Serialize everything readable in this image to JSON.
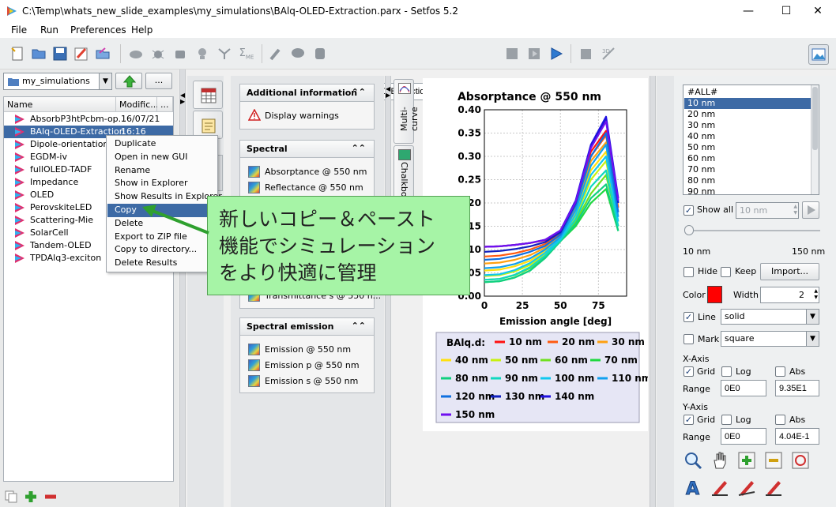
{
  "window": {
    "title": "C:\\Temp\\whats_new_slide_examples\\my_simulations\\BAlq-OLED-Extraction.parx - Setfos 5.2",
    "minimize": "—",
    "maximize": "☐",
    "close": "✕"
  },
  "menubar": {
    "items": [
      "File",
      "Run",
      "Preferences",
      "Help"
    ]
  },
  "toolbar": {
    "simulation_name": "BAlq-OLED-Extraction"
  },
  "left": {
    "folder": "my_simulations",
    "more_button": "...",
    "columns": {
      "name": "Name",
      "modified": "Modific...",
      "more": "..."
    },
    "files": [
      {
        "name": "AbsorbP3htPcbm-op...",
        "date": "16/07/21"
      },
      {
        "name": "BAlq-OLED-Extraction",
        "date": "16:16"
      },
      {
        "name": "Dipole-orientation",
        "date": ""
      },
      {
        "name": "EGDM-iv",
        "date": ""
      },
      {
        "name": "fullOLED-TADF",
        "date": ""
      },
      {
        "name": "Impedance",
        "date": ""
      },
      {
        "name": "OLED",
        "date": ""
      },
      {
        "name": "PerovskiteLED",
        "date": ""
      },
      {
        "name": "Scattering-Mie",
        "date": ""
      },
      {
        "name": "SolarCell",
        "date": ""
      },
      {
        "name": "Tandem-OLED",
        "date": ""
      },
      {
        "name": "TPDAlq3-exciton",
        "date": ""
      }
    ]
  },
  "context_menu": {
    "items": [
      "Duplicate",
      "Open in new GUI",
      "Rename",
      "Show in Explorer",
      "Show Results in Explorer",
      "Copy",
      "Delete",
      "Export to ZIP file",
      "Copy to directory...",
      "Delete Results"
    ],
    "highlighted": "Copy"
  },
  "callout": {
    "lines": [
      "新しいコピー＆ペースト",
      "機能でシミュレーション",
      "をより快適に管理"
    ]
  },
  "middle": {
    "sections": [
      {
        "title": "Additional information",
        "items": [
          "Display warnings"
        ]
      },
      {
        "title": "Spectral",
        "items": [
          "Absorptance @ 550 nm",
          "Reflectance @ 550 nm"
        ],
        "hidden_item": "Transmittance s @ 550 n..."
      },
      {
        "title": "Spectral emission",
        "items": [
          "Emission @ 550 nm",
          "Emission p @ 550 nm",
          "Emission s @ 550 nm"
        ]
      }
    ],
    "side_tabs": [
      "Multi-curve",
      "Chalkboard"
    ]
  },
  "chart_data": {
    "type": "line",
    "title": "Absorptance @ 550 nm",
    "xlabel": "Emission angle [deg]",
    "ylabel": "",
    "xlim": [
      0,
      93.5
    ],
    "ylim": [
      0,
      0.4
    ],
    "xticks": [
      0,
      25,
      50,
      75
    ],
    "yticks": [
      "0.00",
      "0.05",
      "0.10",
      "0.15",
      "0.20",
      "0.25",
      "0.30",
      "0.35",
      "0.40"
    ],
    "grid": true,
    "legend_title": "BAlq.d:",
    "legend_position": "bottom",
    "series": [
      {
        "name": "10 nm",
        "color": "#ff1010",
        "values": [
          0.106,
          0.107,
          0.11,
          0.114,
          0.12,
          0.14,
          0.2,
          0.31,
          0.355,
          0.2
        ]
      },
      {
        "name": "20 nm",
        "color": "#ff5a10",
        "values": [
          0.085,
          0.087,
          0.092,
          0.1,
          0.112,
          0.135,
          0.195,
          0.3,
          0.345,
          0.19
        ]
      },
      {
        "name": "30 nm",
        "color": "#ffa010",
        "values": [
          0.07,
          0.072,
          0.078,
          0.088,
          0.104,
          0.13,
          0.19,
          0.29,
          0.33,
          0.18
        ]
      },
      {
        "name": "40 nm",
        "color": "#ffe010",
        "values": [
          0.055,
          0.057,
          0.064,
          0.076,
          0.097,
          0.126,
          0.18,
          0.27,
          0.31,
          0.17
        ]
      },
      {
        "name": "50 nm",
        "color": "#c8f010",
        "values": [
          0.043,
          0.045,
          0.053,
          0.067,
          0.09,
          0.122,
          0.17,
          0.25,
          0.29,
          0.16
        ]
      },
      {
        "name": "60 nm",
        "color": "#70e020",
        "values": [
          0.035,
          0.037,
          0.045,
          0.06,
          0.085,
          0.12,
          0.16,
          0.22,
          0.26,
          0.15
        ]
      },
      {
        "name": "70 nm",
        "color": "#20d840",
        "values": [
          0.03,
          0.032,
          0.04,
          0.055,
          0.082,
          0.118,
          0.15,
          0.2,
          0.23,
          0.14
        ]
      },
      {
        "name": "80 nm",
        "color": "#10d080",
        "values": [
          0.03,
          0.032,
          0.04,
          0.055,
          0.082,
          0.118,
          0.155,
          0.21,
          0.24,
          0.14
        ]
      },
      {
        "name": "90 nm",
        "color": "#10d8c0",
        "values": [
          0.035,
          0.037,
          0.046,
          0.062,
          0.087,
          0.12,
          0.165,
          0.235,
          0.27,
          0.15
        ]
      },
      {
        "name": "100 nm",
        "color": "#10c8f0",
        "values": [
          0.045,
          0.047,
          0.056,
          0.071,
          0.093,
          0.123,
          0.175,
          0.26,
          0.3,
          0.16
        ]
      },
      {
        "name": "110 nm",
        "color": "#10a0f0",
        "values": [
          0.06,
          0.062,
          0.069,
          0.081,
          0.1,
          0.127,
          0.185,
          0.28,
          0.325,
          0.17
        ]
      },
      {
        "name": "120 nm",
        "color": "#1070e0",
        "values": [
          0.078,
          0.08,
          0.086,
          0.095,
          0.108,
          0.132,
          0.195,
          0.3,
          0.35,
          0.18
        ]
      },
      {
        "name": "130 nm",
        "color": "#1020c0",
        "values": [
          0.095,
          0.097,
          0.101,
          0.107,
          0.116,
          0.137,
          0.2,
          0.32,
          0.38,
          0.2
        ]
      },
      {
        "name": "140 nm",
        "color": "#2010e0",
        "values": [
          0.106,
          0.107,
          0.11,
          0.114,
          0.121,
          0.141,
          0.205,
          0.325,
          0.385,
          0.21
        ]
      },
      {
        "name": "150 nm",
        "color": "#7010f0",
        "values": [
          0.106,
          0.107,
          0.11,
          0.114,
          0.121,
          0.141,
          0.202,
          0.318,
          0.375,
          0.205
        ]
      }
    ],
    "x": [
      0,
      10,
      20,
      30,
      40,
      50,
      60,
      70,
      80,
      88
    ]
  },
  "right": {
    "list_items": [
      "#ALL#",
      "10 nm",
      "20 nm",
      "30 nm",
      "40 nm",
      "50 nm",
      "60 nm",
      "70 nm",
      "80 nm",
      "90 nm"
    ],
    "selected_item": "10 nm",
    "show_all": "Show all",
    "show_all_value": "10 nm",
    "slider_min": "10 nm",
    "slider_max": "150 nm",
    "hide": "Hide",
    "keep": "Keep",
    "import": "Import...",
    "color_label": "Color",
    "color_value": "#ff0000",
    "width_label": "Width",
    "width_value": "2",
    "line_label": "Line",
    "line_style": "solid",
    "mark_label": "Mark",
    "mark_style": "square",
    "xaxis": {
      "title": "X-Axis",
      "grid": "Grid",
      "log": "Log",
      "abs": "Abs",
      "range_label": "Range",
      "min": "0E0",
      "max": "9.35E1"
    },
    "yaxis": {
      "title": "Y-Axis",
      "grid": "Grid",
      "log": "Log",
      "abs": "Abs",
      "range_label": "Range",
      "min": "0E0",
      "max": "4.04E-1"
    }
  }
}
